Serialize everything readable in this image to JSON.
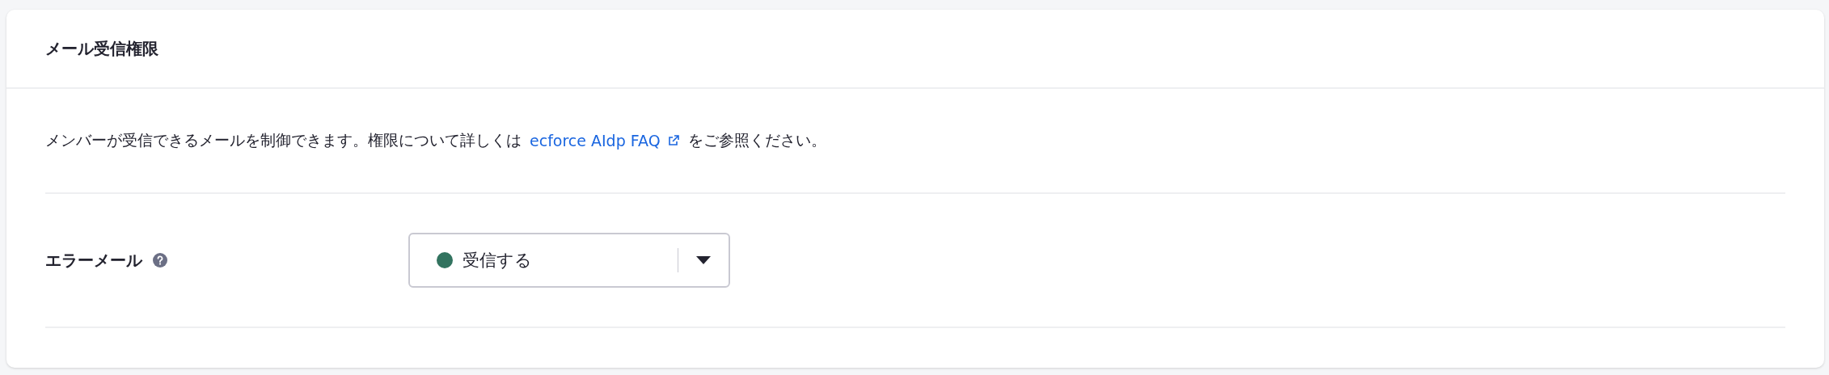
{
  "card": {
    "title": "メール受信権限"
  },
  "description": {
    "before": "メンバーが受信できるメールを制御できます。権限について詳しくは",
    "link": "ecforce AIdp FAQ",
    "after": "をご参照ください。"
  },
  "settings": [
    {
      "label": "エラーメール",
      "help": true,
      "select": {
        "value": "受信する",
        "color": "#32735f"
      }
    }
  ]
}
